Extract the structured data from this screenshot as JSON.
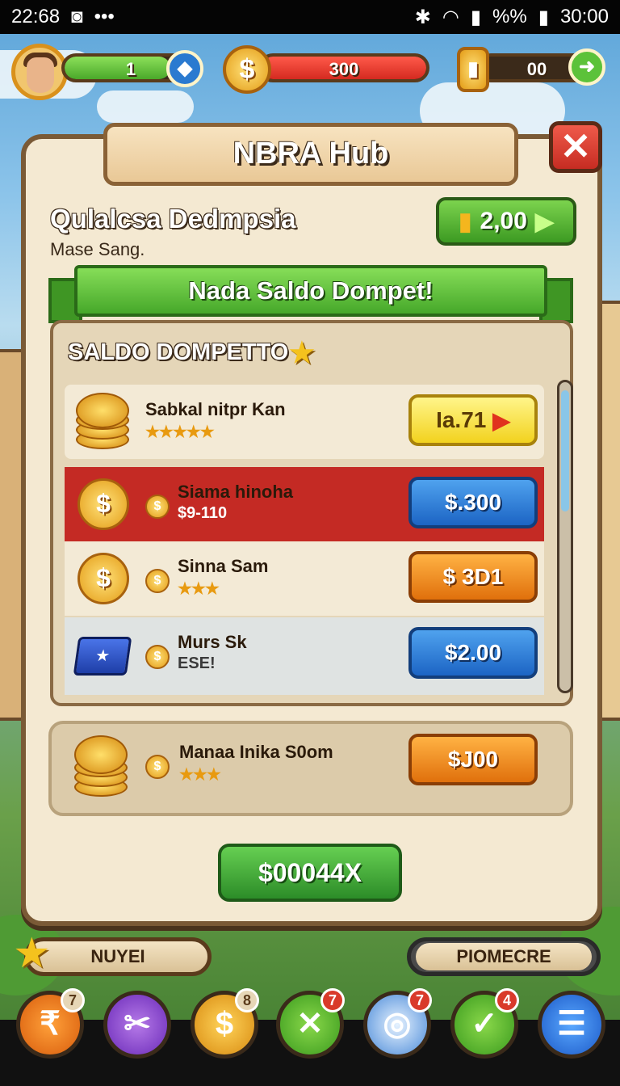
{
  "status_bar": {
    "time": "22:68",
    "right_text": "%%",
    "clock": "30:00"
  },
  "hud": {
    "level_value": "1",
    "coins_value": "300",
    "tickets_value": "00"
  },
  "panel": {
    "title": "NBRA Hub",
    "heading": "Qulalcsa Dedmpsia",
    "subheading": "Mase Sang.",
    "balance_value": "2,00",
    "banner": "Nada Saldo Dompet!",
    "list_title": "SALDO DOMPETTO"
  },
  "items": [
    {
      "name": "Sabkal nitpr Kan",
      "sub": "★★★★★",
      "price": "Ia.71"
    },
    {
      "name": "Siama hinoha",
      "sub": "$9-110",
      "price": "$.300"
    },
    {
      "name": "Sinna Sam",
      "sub": "★★★",
      "price": "$ 3D1"
    },
    {
      "name": "Murs Sk",
      "sub": "ESE!",
      "price": "$2.00"
    }
  ],
  "bonus_item": {
    "name": "Manaa Inika S0om",
    "sub": "★★★",
    "price": "$J00"
  },
  "claim_button": "$00044X",
  "tabs": {
    "left": "NUYEI",
    "right": "PIOMECRE"
  },
  "nav_badges": [
    "7",
    "",
    "8",
    "7",
    "7",
    "4",
    ""
  ],
  "colors": {
    "accent_green": "#46a82a",
    "danger_red": "#c62c22",
    "highlight_row": "#c42a24",
    "panel_bg": "#f4e9d2"
  }
}
